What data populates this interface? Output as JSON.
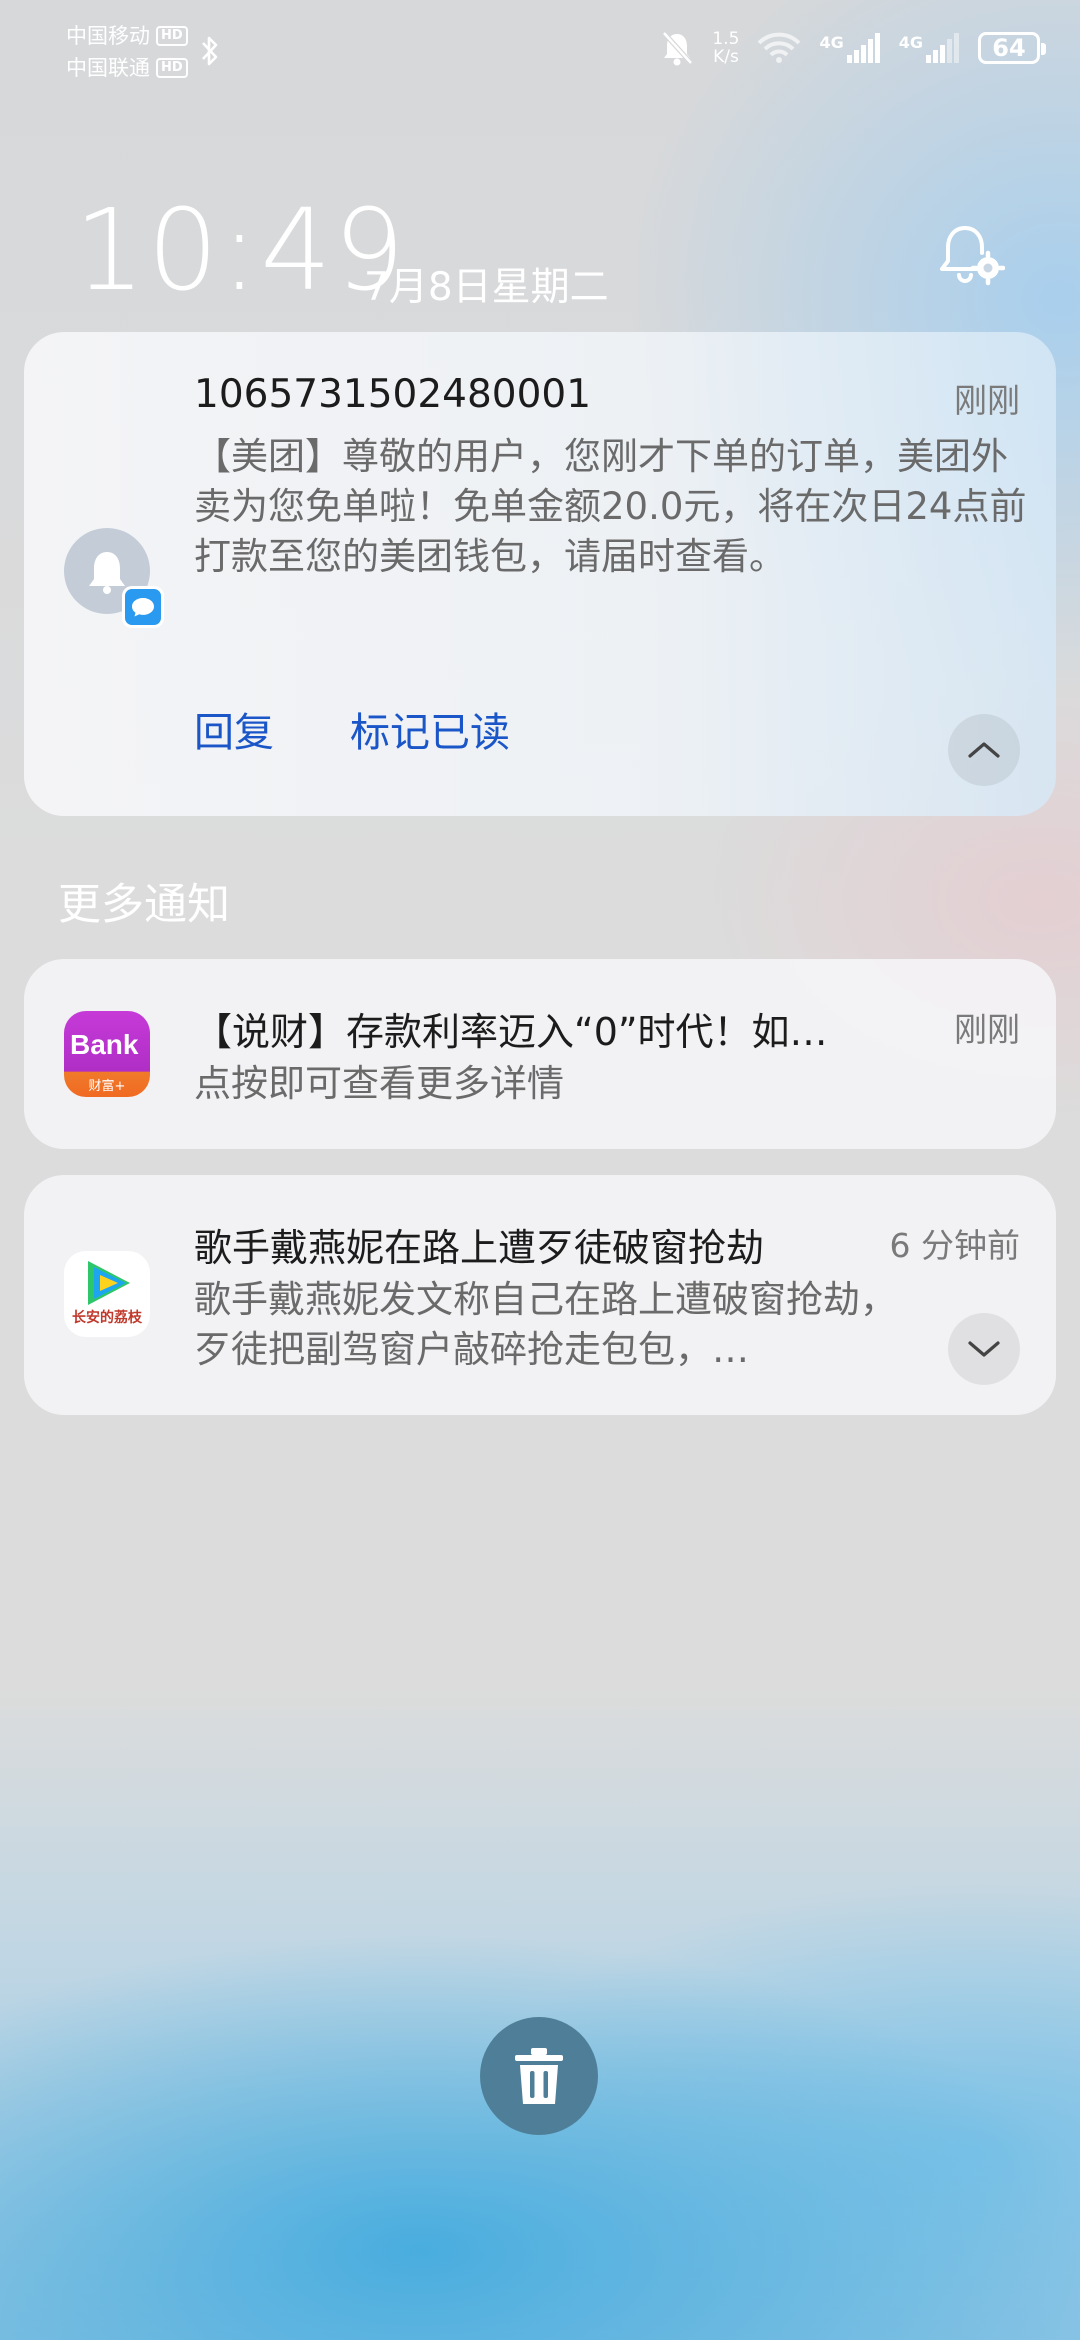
{
  "status_bar": {
    "carrier1": "中国移动",
    "carrier2": "中国联通",
    "hd_label": "HD",
    "net_speed_value": "1.5",
    "net_speed_unit": "K/s",
    "network1": "4G",
    "network2": "4G",
    "battery": "64",
    "icons": [
      "bluetooth-icon",
      "mute-bell-icon",
      "wifi-icon",
      "signal-icon",
      "battery-icon"
    ]
  },
  "lock": {
    "time": "10:49",
    "date": "7月8日星期二"
  },
  "notifications": [
    {
      "title": "1065731502480001",
      "time": "刚刚",
      "body": "【美团】尊敬的用户，您刚才下单的订单，美团外卖为您免单啦！免单金额20.0元，将在次日24点前打款至您的美团钱包，请届时查看。",
      "actions": [
        "回复",
        "标记已读"
      ]
    }
  ],
  "more_label": "更多通知",
  "more_notifications": [
    {
      "icon_text": "Bank",
      "icon_sub": "财富+",
      "title": "【说财】存款利率迈入“0”时代！如…",
      "time": "刚刚",
      "body": "点按即可查看更多详情"
    },
    {
      "icon_text": "长安的荔枝",
      "title": "歌手戴燕妮在路上遭歹徒破窗抢劫",
      "time": "6 分钟前",
      "body": "歌手戴燕妮发文称自己在路上遭破窗抢劫，歹徒把副驾窗户敲碎抢走包包，…"
    }
  ],
  "colors": {
    "action_blue": "#1a56c8",
    "sms_badge": "#2a9af0",
    "bank_purple": "#c13ad6",
    "trash_bg": "#4f7f98"
  }
}
